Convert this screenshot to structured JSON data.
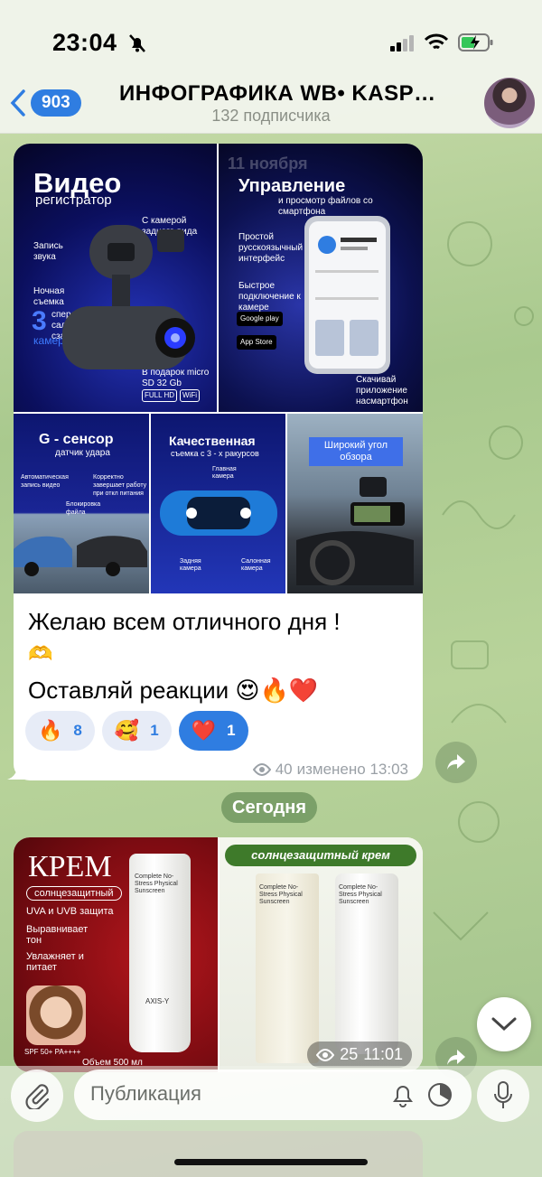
{
  "status_bar": {
    "time": "23:04"
  },
  "header": {
    "back_count": "903",
    "title": "ИНФОГРАФИКА WB• KASP…",
    "subtitle": "132 подписчика"
  },
  "post1": {
    "image_video": {
      "title": "Видео",
      "subtitle": "регистратор",
      "rear_camera": "С камерой заднего вида",
      "sound": "Запись звука",
      "night": "Ночная съемка",
      "cameras_num": "3",
      "cameras_text": "спереди салон сзади",
      "cameras_label": "камеры",
      "gift": "В подарок micro SD 32 Gb",
      "fullhd": "FULL HD",
      "wifi": "WiFi"
    },
    "image_control": {
      "overlay_date": "11 ноября",
      "title": "Управление",
      "subtitle": "и просмотр файлов со смартфона",
      "interface": "Простой русскоязычный интерфейс",
      "connect": "Быстрое подключение к камере",
      "google_play": "Google play",
      "app_store": "App Store",
      "download": "Скачивай приложение насмартфон"
    },
    "image_gsensor": {
      "title": "G - сенсор",
      "subtitle": "датчик удара",
      "auto": "Автоматическая запись видео",
      "correct": "Корректно завершает работу при откл питания",
      "lock": "Блокировка файла"
    },
    "image_quality": {
      "title": "Качественная",
      "subtitle": "съемка с 3 - х ракурсов",
      "main": "Главная камера",
      "rear": "Задняя камера",
      "cabin": "Салонная камера"
    },
    "image_wide": {
      "title": "Широкий угол обзора"
    },
    "text_line1": "Желаю всем отличного дня !",
    "text_emoji1": "🫶",
    "text_line2": "Оставляй реакции 😍🔥❤️",
    "reactions": [
      {
        "emoji": "🔥",
        "count": "8"
      },
      {
        "emoji": "🥰",
        "count": "1"
      },
      {
        "emoji": "❤️",
        "count": "1"
      }
    ],
    "views": "40",
    "edited_time": "изменено 13:03"
  },
  "date_chip": "Сегодня",
  "post2": {
    "krem_title": "КРЕМ",
    "krem_sub": "солнцезащитный",
    "uva": "UVA и UVB защита",
    "bullet1": "Выравнивает тон",
    "bullet2": "Увлажняет и питает",
    "spf": "SPF 50+ PA++++",
    "volume": "Объем 500 мл",
    "sun_banner": "солнцезащитный крем",
    "tube_label": "Complete No-Stress Physical Sunscreen",
    "brand": "AXIS-Y",
    "views": "25",
    "time": "11:01"
  },
  "composer": {
    "placeholder": "Публикация"
  },
  "colors": {
    "accent": "#2f7de1",
    "wallpaper": "#b8d39a",
    "bubble": "#ffffff"
  }
}
